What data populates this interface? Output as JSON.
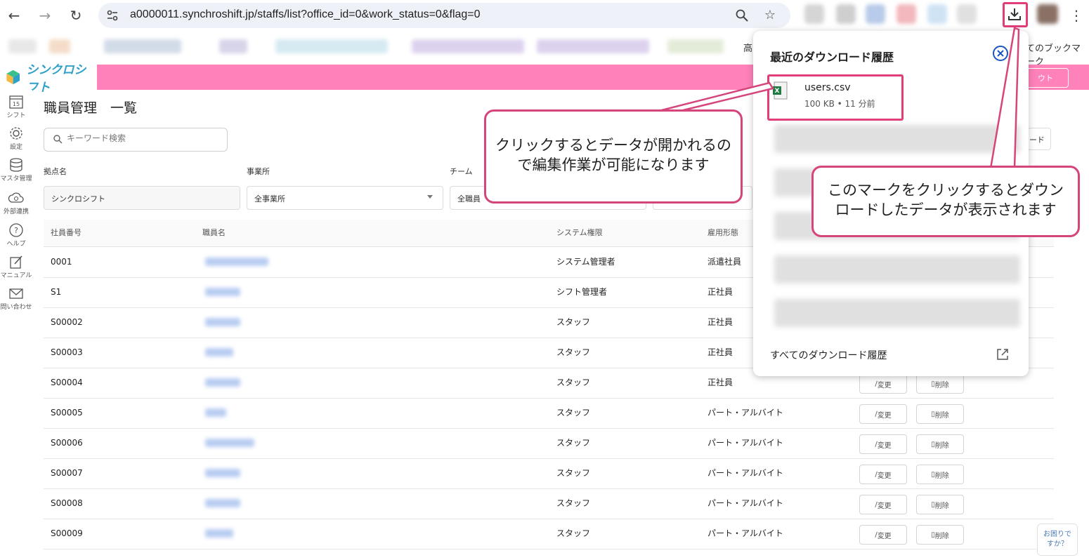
{
  "browser": {
    "url": "a0000011.synchroshift.jp/staffs/list?office_id=0&work_status=0&flag=0",
    "bookmarks_right_label": "てのブックマーク",
    "bookmarks_mid_fragment": "高"
  },
  "app": {
    "logo": "シンクロシフト",
    "logout_fragment": "ウト"
  },
  "sidebar": {
    "items": [
      {
        "label": "シフト",
        "icon": "calendar-icon",
        "icon_text": "15"
      },
      {
        "label": "設定",
        "icon": "gear-icon"
      },
      {
        "label": "マスタ管理",
        "icon": "database-icon"
      },
      {
        "label": "外部連携",
        "icon": "cloud-sync-icon"
      },
      {
        "label": "ヘルプ",
        "icon": "help-icon"
      },
      {
        "label": "マニュアル",
        "icon": "edit-icon"
      },
      {
        "label": "問い合わせ",
        "icon": "mail-icon"
      }
    ]
  },
  "main": {
    "title": "職員管理　一覧",
    "search_placeholder": "キーワード検索",
    "partial_button": "ード",
    "filters": [
      {
        "label": "拠点名",
        "value": "シンクロシフト"
      },
      {
        "label": "事業所",
        "value": "全事業所"
      },
      {
        "label": "チーム",
        "value": "全職員"
      }
    ],
    "table": {
      "headers": [
        "社員番号",
        "職員名",
        "システム権限",
        "雇用形態"
      ],
      "rows": [
        {
          "id": "0001",
          "role": "システム管理者",
          "type": "派遣社員"
        },
        {
          "id": "S1",
          "role": "シフト管理者",
          "type": "正社員"
        },
        {
          "id": "S00002",
          "role": "スタッフ",
          "type": "正社員"
        },
        {
          "id": "S00003",
          "role": "スタッフ",
          "type": "正社員"
        },
        {
          "id": "S00004",
          "role": "スタッフ",
          "type": "正社員"
        },
        {
          "id": "S00005",
          "role": "スタッフ",
          "type": "パート・アルバイト"
        },
        {
          "id": "S00006",
          "role": "スタッフ",
          "type": "パート・アルバイト"
        },
        {
          "id": "S00007",
          "role": "スタッフ",
          "type": "パート・アルバイト"
        },
        {
          "id": "S00008",
          "role": "スタッフ",
          "type": "パート・アルバイト"
        },
        {
          "id": "S00009",
          "role": "スタッフ",
          "type": "パート・アルバイト"
        }
      ],
      "edit_label": "変更",
      "delete_label": "削除"
    }
  },
  "download_panel": {
    "title": "最近のダウンロード履歴",
    "file_name": "users.csv",
    "file_meta": "100 KB • 11 分前",
    "all_history": "すべてのダウンロード履歴"
  },
  "callouts": {
    "file_note_line1": "クリックするとデータが開かれるの",
    "file_note_line2": "で編集作業が可能になります",
    "button_note_line1": "このマークをクリックするとダウン",
    "button_note_line2": "ロードしたデータが表示されます"
  },
  "help_widget": {
    "line1": "お困りで",
    "line2": "すか？"
  },
  "colors": {
    "header_pink": "#ff82bb",
    "highlight": "#e23d79",
    "logo_blue": "#2fa0c8"
  }
}
